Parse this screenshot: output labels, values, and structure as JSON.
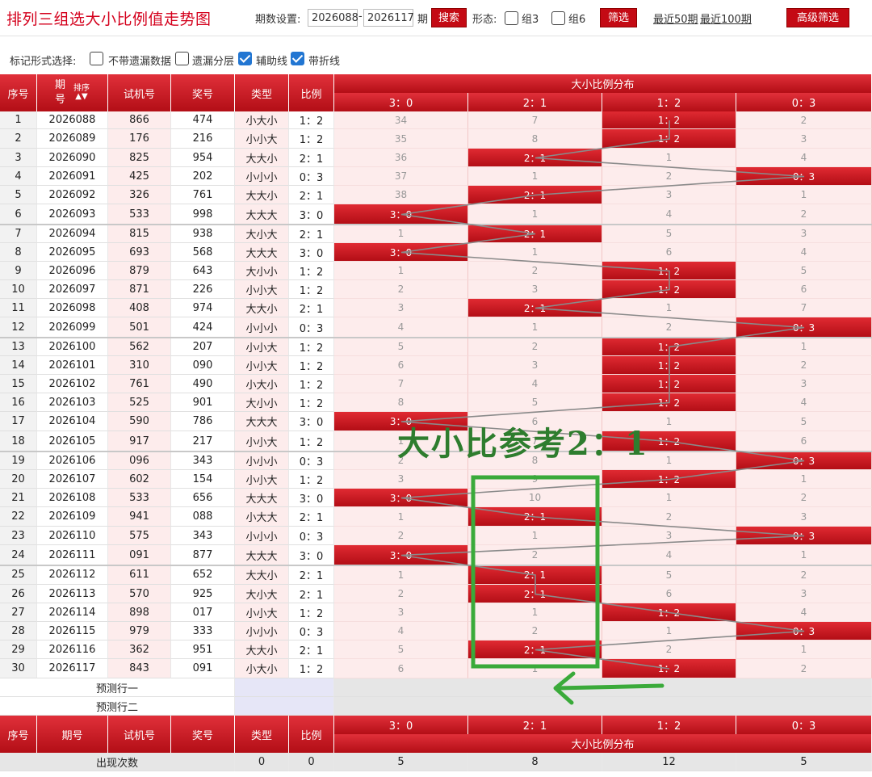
{
  "toolbar": {
    "title": "排列三组选大小比例值走势图",
    "period_label": "期数设置:",
    "period_from": "2026088",
    "period_to": "2026117",
    "period_unit": "期",
    "search_button": "搜索",
    "shape_label": "形态:",
    "group3_label": "组3",
    "group6_label": "组6",
    "filter_button": "筛选",
    "recent50": "最近50期",
    "recent100": "最近100期",
    "advanced_button": "高级筛选"
  },
  "options": {
    "label": "标记形式选择:",
    "items": [
      {
        "label": "不带遗漏数据",
        "checked": false
      },
      {
        "label": "遗漏分层",
        "checked": false
      },
      {
        "label": "辅助线",
        "checked": true
      },
      {
        "label": "带折线",
        "checked": true
      }
    ]
  },
  "table": {
    "headers": {
      "seq": "序号",
      "issue_a": "期",
      "issue_b": "号",
      "sort": "排序",
      "test": "试机号",
      "prize": "奖号",
      "type": "类型",
      "ratio": "比例",
      "dist": "大小比例分布"
    },
    "dist_columns": [
      "3：0",
      "2：1",
      "1：2",
      "0：3"
    ],
    "rows": [
      {
        "seq": "1",
        "issue": "2026088",
        "test": "866",
        "prize": "474",
        "type": "小大小",
        "ratio": "1：2",
        "dist": [
          "34",
          "7",
          "1：2",
          "2"
        ],
        "hit": 2
      },
      {
        "seq": "2",
        "issue": "2026089",
        "test": "176",
        "prize": "216",
        "type": "小小大",
        "ratio": "1：2",
        "dist": [
          "35",
          "8",
          "1：2",
          "3"
        ],
        "hit": 2
      },
      {
        "seq": "3",
        "issue": "2026090",
        "test": "825",
        "prize": "954",
        "type": "大大小",
        "ratio": "2：1",
        "dist": [
          "36",
          "2：1",
          "1",
          "4"
        ],
        "hit": 1
      },
      {
        "seq": "4",
        "issue": "2026091",
        "test": "425",
        "prize": "202",
        "type": "小小小",
        "ratio": "0：3",
        "dist": [
          "37",
          "1",
          "2",
          "0：3"
        ],
        "hit": 3
      },
      {
        "seq": "5",
        "issue": "2026092",
        "test": "326",
        "prize": "761",
        "type": "大大小",
        "ratio": "2：1",
        "dist": [
          "38",
          "2：1",
          "3",
          "1"
        ],
        "hit": 1
      },
      {
        "seq": "6",
        "issue": "2026093",
        "test": "533",
        "prize": "998",
        "type": "大大大",
        "ratio": "3：0",
        "dist": [
          "3：0",
          "1",
          "4",
          "2"
        ],
        "hit": 0
      },
      {
        "seq": "7",
        "issue": "2026094",
        "test": "815",
        "prize": "938",
        "type": "大小大",
        "ratio": "2：1",
        "dist": [
          "1",
          "2：1",
          "5",
          "3"
        ],
        "hit": 1
      },
      {
        "seq": "8",
        "issue": "2026095",
        "test": "693",
        "prize": "568",
        "type": "大大大",
        "ratio": "3：0",
        "dist": [
          "3：0",
          "1",
          "6",
          "4"
        ],
        "hit": 0
      },
      {
        "seq": "9",
        "issue": "2026096",
        "test": "879",
        "prize": "643",
        "type": "大小小",
        "ratio": "1：2",
        "dist": [
          "1",
          "2",
          "1：2",
          "5"
        ],
        "hit": 2
      },
      {
        "seq": "10",
        "issue": "2026097",
        "test": "871",
        "prize": "226",
        "type": "小小大",
        "ratio": "1：2",
        "dist": [
          "2",
          "3",
          "1：2",
          "6"
        ],
        "hit": 2
      },
      {
        "seq": "11",
        "issue": "2026098",
        "test": "408",
        "prize": "974",
        "type": "大大小",
        "ratio": "2：1",
        "dist": [
          "3",
          "2：1",
          "1",
          "7"
        ],
        "hit": 1
      },
      {
        "seq": "12",
        "issue": "2026099",
        "test": "501",
        "prize": "424",
        "type": "小小小",
        "ratio": "0：3",
        "dist": [
          "4",
          "1",
          "2",
          "0：3"
        ],
        "hit": 3
      },
      {
        "seq": "13",
        "issue": "2026100",
        "test": "562",
        "prize": "207",
        "type": "小小大",
        "ratio": "1：2",
        "dist": [
          "5",
          "2",
          "1：2",
          "1"
        ],
        "hit": 2
      },
      {
        "seq": "14",
        "issue": "2026101",
        "test": "310",
        "prize": "090",
        "type": "小小大",
        "ratio": "1：2",
        "dist": [
          "6",
          "3",
          "1：2",
          "2"
        ],
        "hit": 2
      },
      {
        "seq": "15",
        "issue": "2026102",
        "test": "761",
        "prize": "490",
        "type": "小大小",
        "ratio": "1：2",
        "dist": [
          "7",
          "4",
          "1：2",
          "3"
        ],
        "hit": 2
      },
      {
        "seq": "16",
        "issue": "2026103",
        "test": "525",
        "prize": "901",
        "type": "大小小",
        "ratio": "1：2",
        "dist": [
          "8",
          "5",
          "1：2",
          "4"
        ],
        "hit": 2
      },
      {
        "seq": "17",
        "issue": "2026104",
        "test": "590",
        "prize": "786",
        "type": "大大大",
        "ratio": "3：0",
        "dist": [
          "3：0",
          "6",
          "1",
          "5"
        ],
        "hit": 0
      },
      {
        "seq": "18",
        "issue": "2026105",
        "test": "917",
        "prize": "217",
        "type": "小小大",
        "ratio": "1：2",
        "dist": [
          "1",
          "7",
          "1：2",
          "6"
        ],
        "hit": 2
      },
      {
        "seq": "19",
        "issue": "2026106",
        "test": "096",
        "prize": "343",
        "type": "小小小",
        "ratio": "0：3",
        "dist": [
          "2",
          "8",
          "1",
          "0：3"
        ],
        "hit": 3
      },
      {
        "seq": "20",
        "issue": "2026107",
        "test": "602",
        "prize": "154",
        "type": "小小大",
        "ratio": "1：2",
        "dist": [
          "3",
          "9",
          "1：2",
          "1"
        ],
        "hit": 2
      },
      {
        "seq": "21",
        "issue": "2026108",
        "test": "533",
        "prize": "656",
        "type": "大大大",
        "ratio": "3：0",
        "dist": [
          "3：0",
          "10",
          "1",
          "2"
        ],
        "hit": 0
      },
      {
        "seq": "22",
        "issue": "2026109",
        "test": "941",
        "prize": "088",
        "type": "小大大",
        "ratio": "2：1",
        "dist": [
          "1",
          "2：1",
          "2",
          "3"
        ],
        "hit": 1
      },
      {
        "seq": "23",
        "issue": "2026110",
        "test": "575",
        "prize": "343",
        "type": "小小小",
        "ratio": "0：3",
        "dist": [
          "2",
          "1",
          "3",
          "0：3"
        ],
        "hit": 3
      },
      {
        "seq": "24",
        "issue": "2026111",
        "test": "091",
        "prize": "877",
        "type": "大大大",
        "ratio": "3：0",
        "dist": [
          "3：0",
          "2",
          "4",
          "1"
        ],
        "hit": 0
      },
      {
        "seq": "25",
        "issue": "2026112",
        "test": "611",
        "prize": "652",
        "type": "大大小",
        "ratio": "2：1",
        "dist": [
          "1",
          "2：1",
          "5",
          "2"
        ],
        "hit": 1
      },
      {
        "seq": "26",
        "issue": "2026113",
        "test": "570",
        "prize": "925",
        "type": "大小大",
        "ratio": "2：1",
        "dist": [
          "2",
          "2：1",
          "6",
          "3"
        ],
        "hit": 1
      },
      {
        "seq": "27",
        "issue": "2026114",
        "test": "898",
        "prize": "017",
        "type": "小小大",
        "ratio": "1：2",
        "dist": [
          "3",
          "1",
          "1：2",
          "4"
        ],
        "hit": 2
      },
      {
        "seq": "28",
        "issue": "2026115",
        "test": "979",
        "prize": "333",
        "type": "小小小",
        "ratio": "0：3",
        "dist": [
          "4",
          "2",
          "1",
          "0：3"
        ],
        "hit": 3
      },
      {
        "seq": "29",
        "issue": "2026116",
        "test": "362",
        "prize": "951",
        "type": "大大小",
        "ratio": "2：1",
        "dist": [
          "5",
          "2：1",
          "2",
          "1"
        ],
        "hit": 1
      },
      {
        "seq": "30",
        "issue": "2026117",
        "test": "843",
        "prize": "091",
        "type": "小大小",
        "ratio": "1：2",
        "dist": [
          "6",
          "1",
          "1：2",
          "2"
        ],
        "hit": 2
      }
    ],
    "predict1": "预测行一",
    "predict2": "预测行二",
    "footer": {
      "seq": "序号",
      "issue": "期号",
      "test": "试机号",
      "prize": "奖号",
      "type": "类型",
      "ratio": "比例",
      "dist": "大小比例分布"
    },
    "stats": {
      "label": "出现次数",
      "type": "0",
      "ratio": "0",
      "dist": [
        "5",
        "8",
        "12",
        "5"
      ]
    }
  },
  "annotation": {
    "text": "大小比参考2：1",
    "color": "#2e7d2e"
  },
  "colors": {
    "header_red": "#c7161e",
    "hit_red": "#d01a22",
    "zone_pink": "#fdecec",
    "annotation_green": "#3aaa3a"
  }
}
